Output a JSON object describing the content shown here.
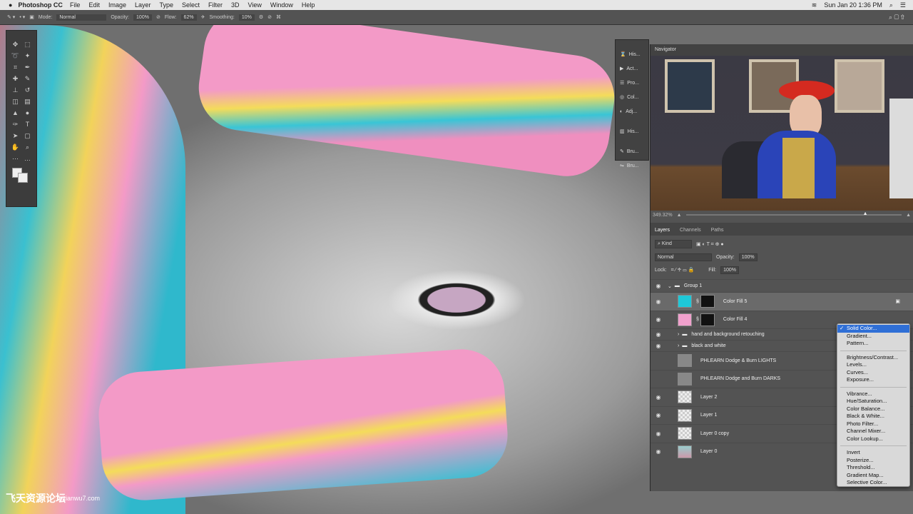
{
  "menubar": {
    "app": "Photoshop CC",
    "items": [
      "File",
      "Edit",
      "Image",
      "Layer",
      "Type",
      "Select",
      "Filter",
      "3D",
      "View",
      "Window",
      "Help"
    ],
    "clock": "Sun Jan 20  1:36 PM"
  },
  "options": {
    "mode_label": "Mode:",
    "mode": "Normal",
    "opacity_label": "Opacity:",
    "opacity": "100%",
    "flow_label": "Flow:",
    "flow": "62%",
    "smoothing_label": "Smoothing:",
    "smoothing": "10%"
  },
  "side_panels": [
    "His...",
    "Act...",
    "Pro...",
    "Col...",
    "Adj...",
    "His...",
    "Bru...",
    "Bru..."
  ],
  "navigator": {
    "tab": "Navigator",
    "zoom": "349.32%",
    "zoom_slider_fraction": 0.82
  },
  "layers_panel": {
    "tabs": [
      "Layers",
      "Channels",
      "Paths"
    ],
    "filter": "Kind",
    "blend": "Normal",
    "opacity_label": "Opacity:",
    "opacity": "100%",
    "lock_label": "Lock:",
    "fill_label": "Fill:",
    "fill": "100%",
    "layers": [
      {
        "name": "Group 1",
        "type": "group"
      },
      {
        "name": "Color Fill 5",
        "type": "fill",
        "color": "#1ec8d8",
        "selected": true
      },
      {
        "name": "Color Fill 4",
        "type": "fill",
        "color": "#f0a0cc"
      },
      {
        "name": "hand and background retouching",
        "type": "group"
      },
      {
        "name": "black and white",
        "type": "group"
      },
      {
        "name": "PHLEARN Dodge & Burn LIGHTS",
        "type": "gray"
      },
      {
        "name": "PHLEARN Dodge and Burn DARKS",
        "type": "gray"
      },
      {
        "name": "Layer 2",
        "type": "trans"
      },
      {
        "name": "Layer 1",
        "type": "trans"
      },
      {
        "name": "Layer 0 copy",
        "type": "trans"
      },
      {
        "name": "Layer 0",
        "type": "photo"
      }
    ]
  },
  "adjustment_menu": {
    "groups": [
      [
        "Solid Color...",
        "Gradient...",
        "Pattern..."
      ],
      [
        "Brightness/Contrast...",
        "Levels...",
        "Curves...",
        "Exposure..."
      ],
      [
        "Vibrance...",
        "Hue/Saturation...",
        "Color Balance...",
        "Black & White...",
        "Photo Filter...",
        "Channel Mixer...",
        "Color Lookup..."
      ],
      [
        "Invert",
        "Posterize...",
        "Threshold...",
        "Gradient Map...",
        "Selective Color..."
      ]
    ],
    "checked": "Solid Color..."
  },
  "watermark": {
    "cn": "飞天资源论坛",
    "url": "feitianwu7.com"
  }
}
